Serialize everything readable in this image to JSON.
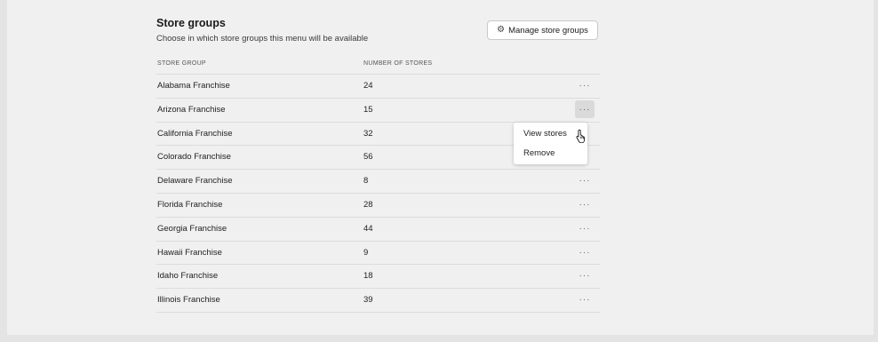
{
  "section": {
    "title": "Store groups",
    "subtitle": "Choose in which store groups this menu will be available",
    "manage_button": "Manage store groups"
  },
  "table": {
    "headers": {
      "group": "STORE GROUP",
      "count": "NUMBER OF STORES"
    },
    "rows": [
      {
        "name": "Alabama Franchise",
        "count": "24"
      },
      {
        "name": "Arizona Franchise",
        "count": "15"
      },
      {
        "name": "California Franchise",
        "count": "32"
      },
      {
        "name": "Colorado Franchise",
        "count": "56"
      },
      {
        "name": "Delaware Franchise",
        "count": "8"
      },
      {
        "name": "Florida Franchise",
        "count": "28"
      },
      {
        "name": "Georgia Franchise",
        "count": "44"
      },
      {
        "name": "Hawaii Franchise",
        "count": "9"
      },
      {
        "name": "Idaho Franchise",
        "count": "18"
      },
      {
        "name": "Illinois Franchise",
        "count": "39"
      }
    ],
    "more_glyph": "···"
  },
  "context_menu": {
    "items": [
      {
        "label": "View stores"
      },
      {
        "label": "Remove"
      }
    ]
  },
  "icons": {
    "manage": "gear-icon",
    "row_action": "more-horizontal-icon",
    "pointer": "hand-pointer-icon"
  },
  "colors": {
    "page_background": "#f0f0f0",
    "outer_background": "#e4e4e4",
    "divider": "#dcdcdc",
    "active_action": "#dadada"
  }
}
